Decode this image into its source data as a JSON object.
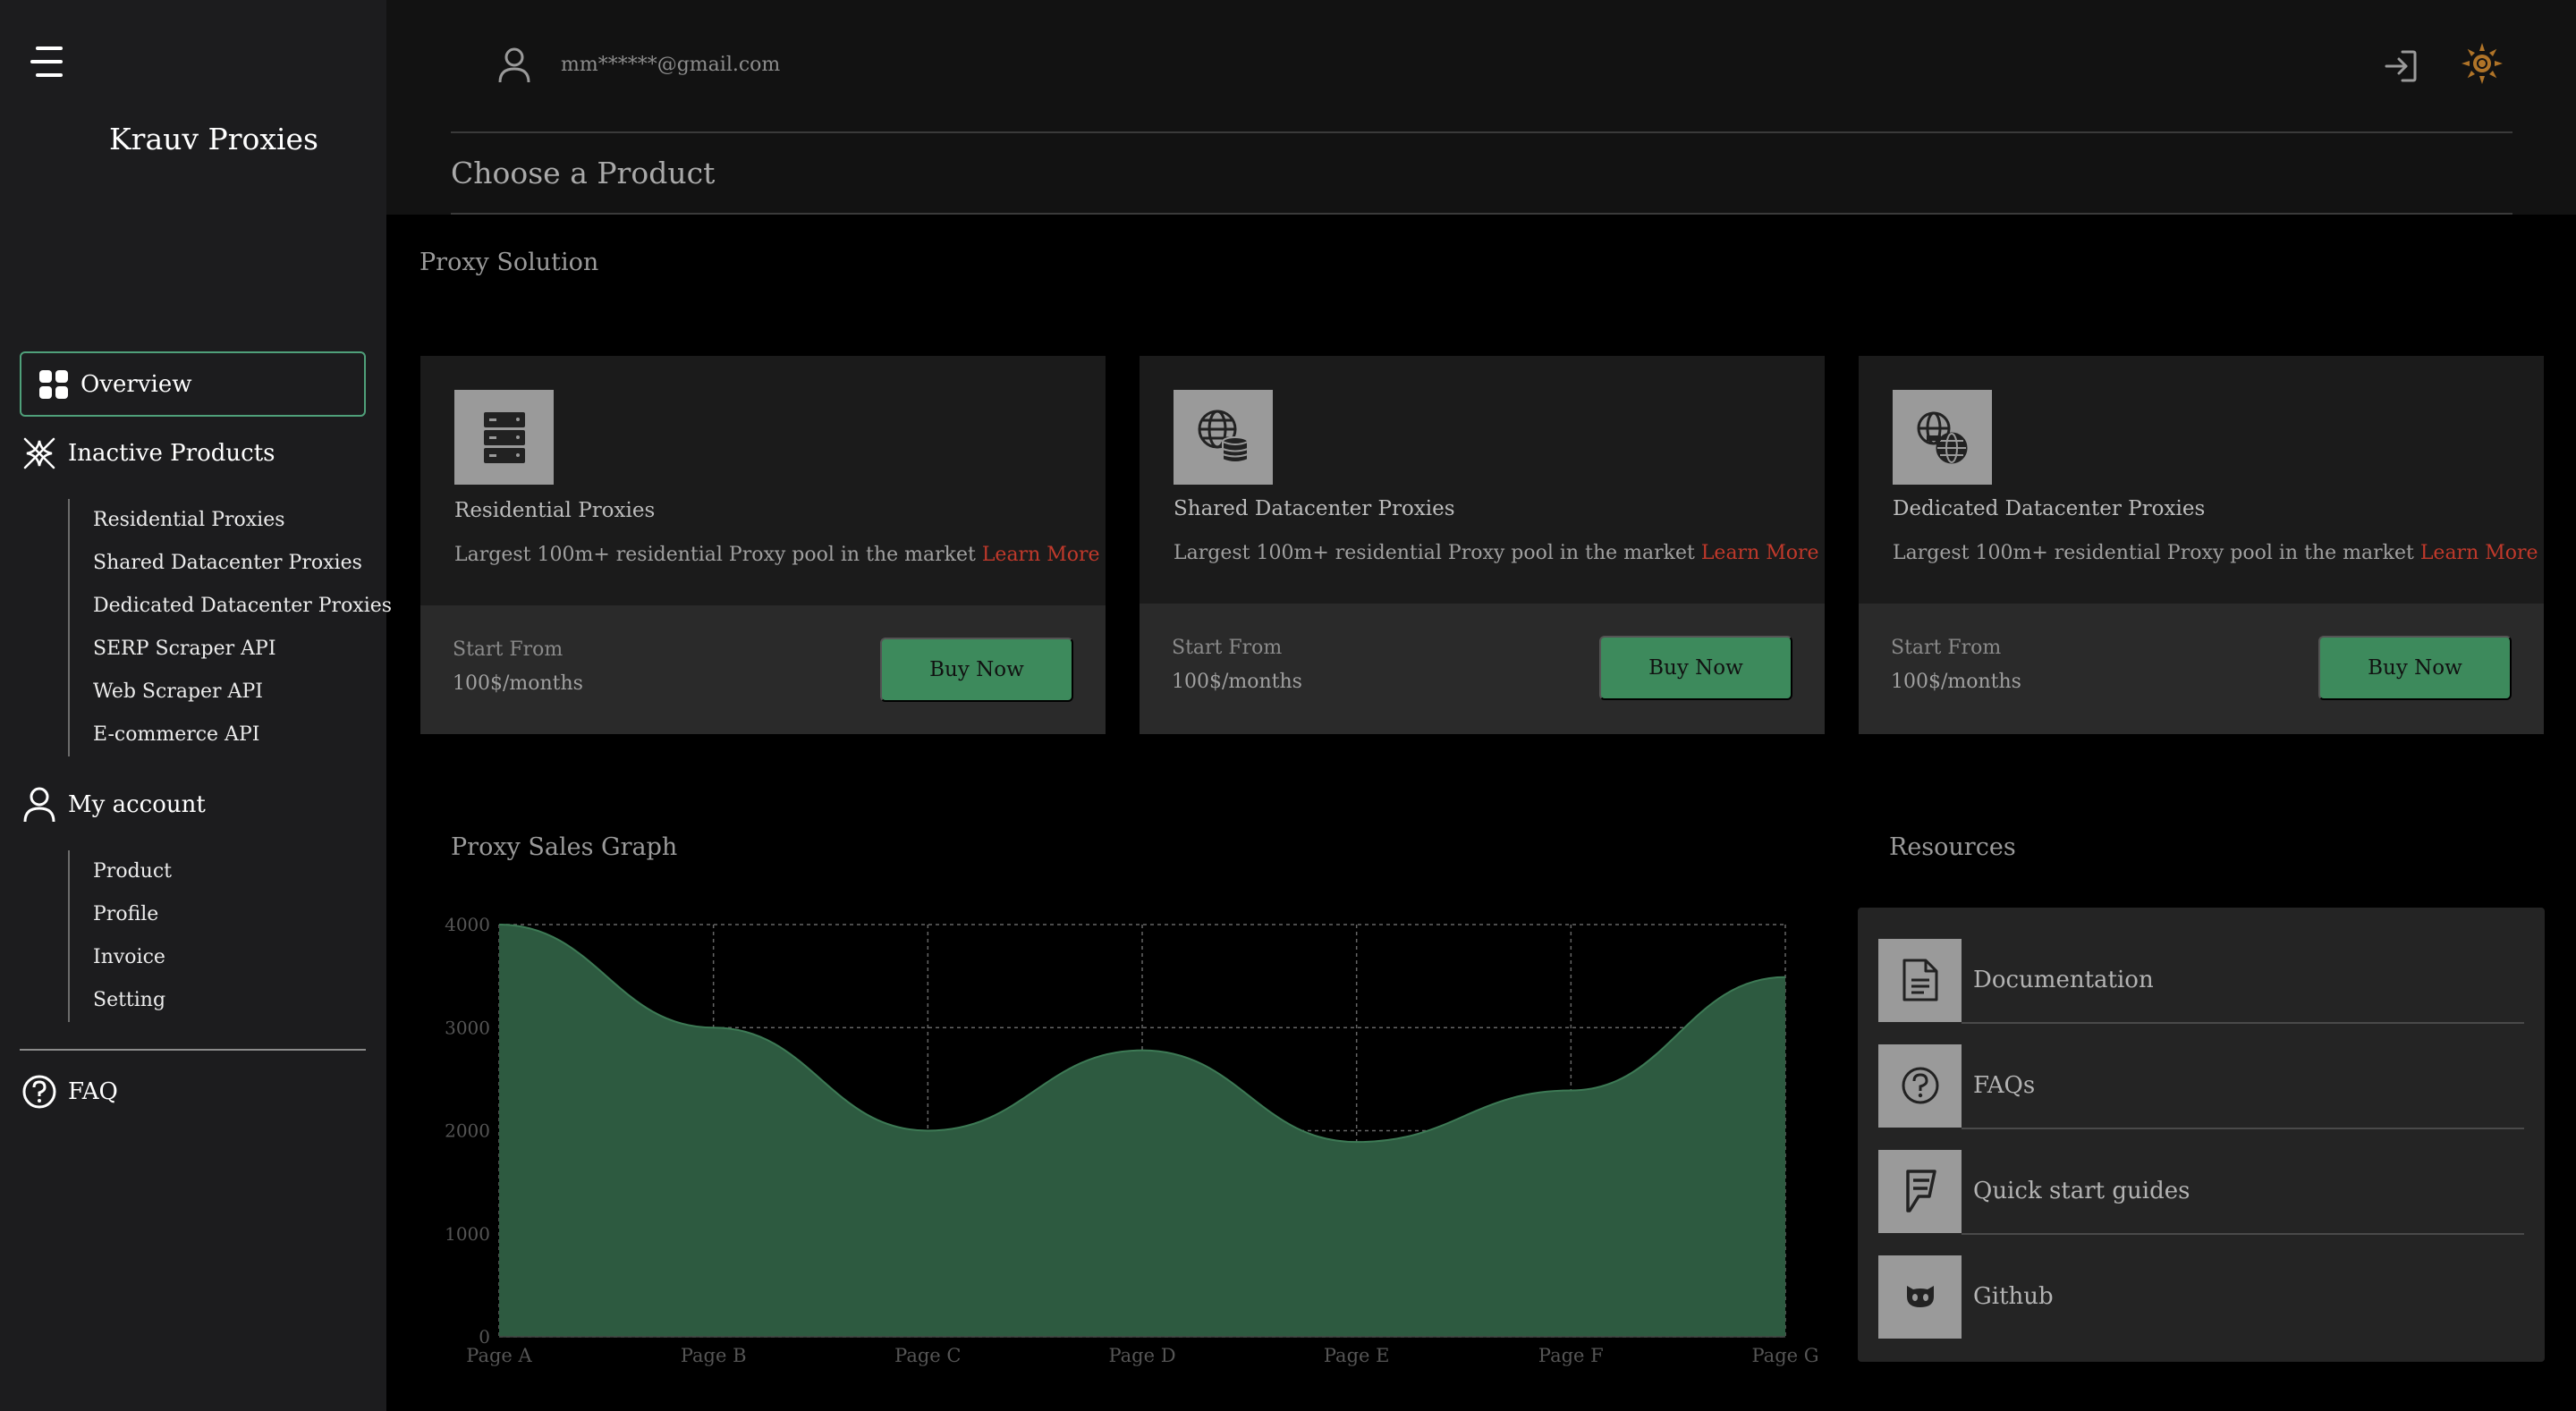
{
  "sidebar": {
    "brand": "Krauv Proxies",
    "overview": "Overview",
    "inactive_products": "Inactive Products",
    "product_items": [
      "Residential Proxies",
      "Shared Datacenter Proxies",
      "Dedicated Datacenter Proxies",
      "SERP Scraper API",
      "Web Scraper API",
      "E-commerce API"
    ],
    "my_account": "My account",
    "account_items": [
      "Product",
      "Profile",
      "Invoice",
      "Setting"
    ],
    "faq": "FAQ"
  },
  "header": {
    "email": "mm******@gmail.com",
    "page_title": "Choose a Product",
    "theme_color": "#b07428"
  },
  "main": {
    "proxy_solution_title": "Proxy Solution",
    "cards": [
      {
        "name": "Residential Proxies",
        "desc": "Largest 100m+ residential Proxy pool in the market",
        "learn_more": "Learn More",
        "start_from": "Start From",
        "price": "100$/months",
        "buy": "Buy Now",
        "icon": "server-rack-icon"
      },
      {
        "name": "Shared Datacenter Proxies",
        "desc": "Largest 100m+ residential Proxy pool in the market",
        "learn_more": "Learn More",
        "start_from": "Start From",
        "price": "100$/months",
        "buy": "Buy Now",
        "icon": "globe-database-icon"
      },
      {
        "name": "Dedicated Datacenter Proxies",
        "desc": "Largest 100m+ residential Proxy pool in the market",
        "learn_more": "Learn More",
        "start_from": "Start From",
        "price": "100$/months",
        "buy": "Buy Now",
        "icon": "globe-network-icon"
      }
    ],
    "graph_title": "Proxy Sales Graph",
    "resources_title": "Resources",
    "resources": [
      {
        "label": "Documentation",
        "icon": "document-icon"
      },
      {
        "label": "FAQs",
        "icon": "question-circle-icon"
      },
      {
        "label": "Quick start guides",
        "icon": "foursquare-icon"
      },
      {
        "label": "Github",
        "icon": "github-icon"
      }
    ]
  },
  "chart_data": {
    "type": "area",
    "categories": [
      "Page A",
      "Page B",
      "Page C",
      "Page D",
      "Page E",
      "Page F",
      "Page G"
    ],
    "series": [
      {
        "values": [
          4000,
          3000,
          2000,
          2780,
          1890,
          2390,
          3490
        ]
      }
    ],
    "ylim": [
      0,
      4000
    ],
    "yticks": [
      0,
      1000,
      2000,
      3000,
      4000
    ],
    "grid": true,
    "fill_color": "#2d5a40",
    "stroke_color": "#3d7a55"
  }
}
